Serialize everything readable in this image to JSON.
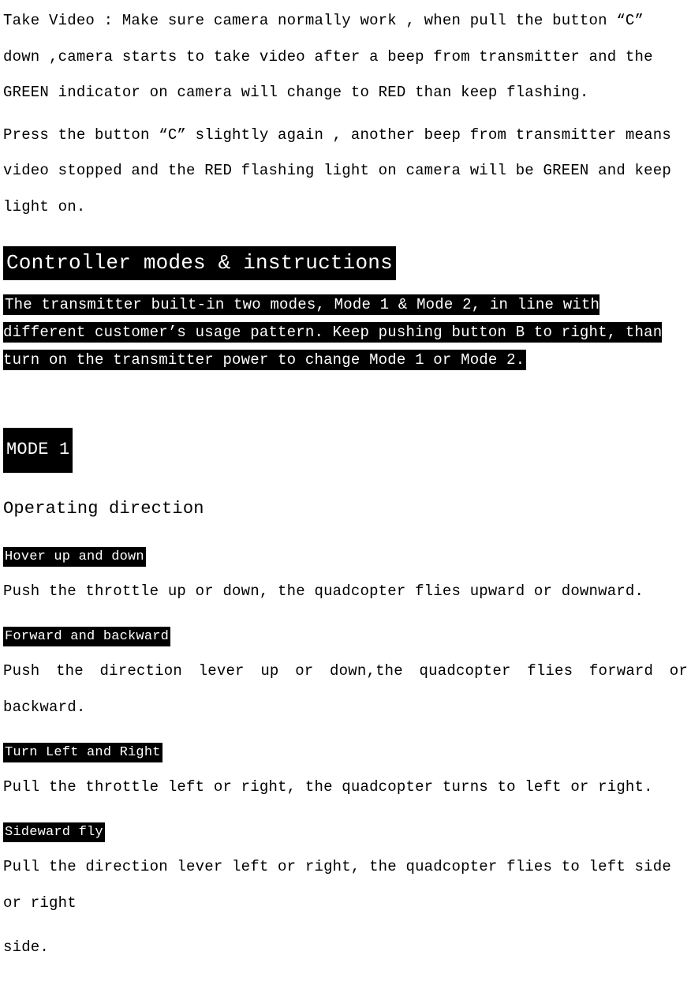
{
  "intro": {
    "para1": "Take Video : Make sure camera normally work , when pull the button “C” down ,camera starts to take video after a beep from transmitter and the GREEN indicator on camera will change to RED than keep flashing.",
    "para2": "Press the button “C” slightly again , another beep from transmitter means video stopped and the RED flashing light on camera will be GREEN and keep light on."
  },
  "controller": {
    "heading": "Controller modes & instructions",
    "desc": "The transmitter built-in two modes, Mode 1 & Mode 2, in line with different customer’s usage pattern. Keep pushing button B to right, than turn on the transmitter power to change Mode 1 or Mode 2."
  },
  "mode1": {
    "title": "MODE 1",
    "subtitle": "Operating direction",
    "sections": [
      {
        "label": "Hover up and down",
        "body": "Push the throttle up or down, the quadcopter flies upward or downward."
      },
      {
        "label": "Forward and backward",
        "body": "Push the direction lever up or down,the quadcopter flies forward or backward."
      },
      {
        "label": "Turn Left and Right",
        "body": "Pull the throttle left or right, the quadcopter turns to left or right."
      },
      {
        "label": "Sideward fly",
        "body": "Pull the direction lever left or right, the quadcopter flies to left side or right"
      }
    ],
    "trailing": "side."
  }
}
